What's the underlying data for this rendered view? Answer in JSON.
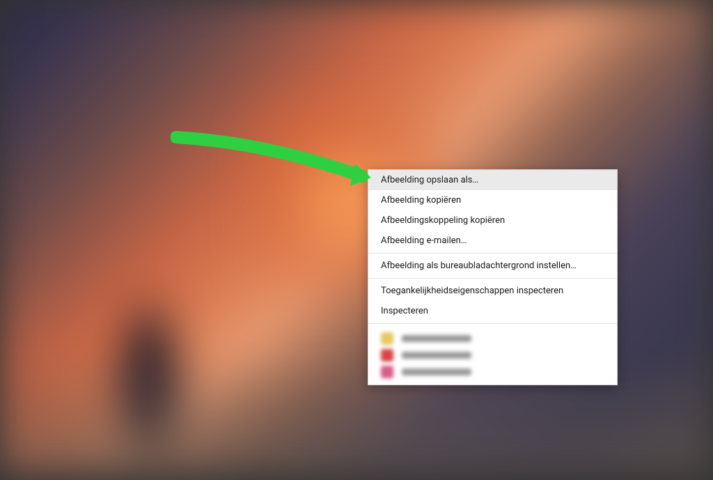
{
  "context_menu": {
    "items": [
      {
        "label": "Afbeelding opslaan als…",
        "highlighted": true
      },
      {
        "label": "Afbeelding kopiëren",
        "highlighted": false
      },
      {
        "label": "Afbeeldingskoppeling kopiëren",
        "highlighted": false
      },
      {
        "label": "Afbeelding e-mailen…",
        "highlighted": false
      }
    ],
    "items2": [
      {
        "label": "Afbeelding als bureaubladachtergrond instellen…",
        "highlighted": false
      }
    ],
    "items3": [
      {
        "label": "Toegankelijkheidseigenschappen inspecteren",
        "highlighted": false
      },
      {
        "label": "Inspecteren",
        "highlighted": false
      }
    ]
  }
}
